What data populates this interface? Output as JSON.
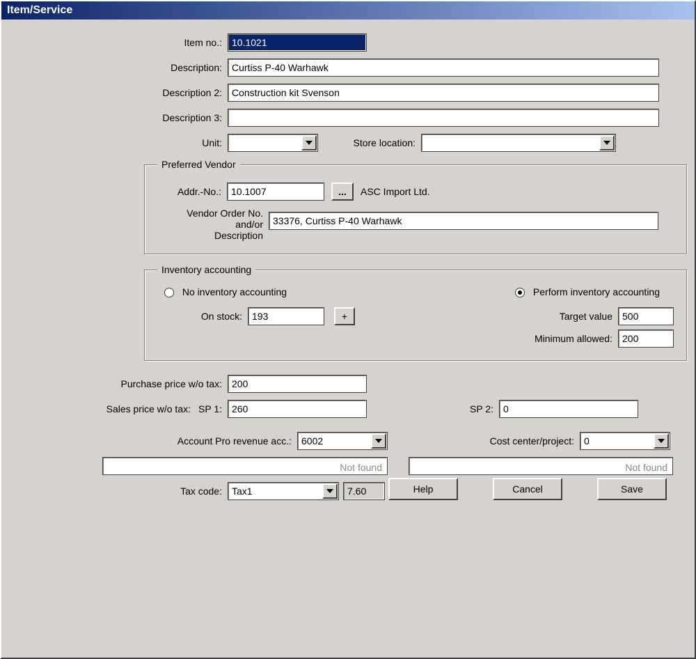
{
  "title": "Item/Service",
  "fields": {
    "item_no": {
      "label": "Item no.:",
      "value": "10.1021"
    },
    "description": {
      "label": "Description:",
      "value": "Curtiss P-40 Warhawk"
    },
    "description2": {
      "label": "Description 2:",
      "value": "Construction kit Svenson"
    },
    "description3": {
      "label": "Description 3:",
      "value": ""
    },
    "unit": {
      "label": "Unit:",
      "value": ""
    },
    "store_location": {
      "label": "Store location:",
      "value": ""
    }
  },
  "vendor": {
    "legend": "Preferred Vendor",
    "addr_no": {
      "label": "Addr.-No.:",
      "value": "10.1007"
    },
    "lookup_btn": "...",
    "vendor_name": "ASC Import Ltd.",
    "order": {
      "label1": "Vendor Order No. and/or",
      "label2": "Description",
      "value": "33376, Curtiss P-40 Warhawk"
    }
  },
  "inventory": {
    "legend": "Inventory accounting",
    "no_inv": "No inventory accounting",
    "perf_inv": "Perform inventory accounting",
    "on_stock": {
      "label": "On stock:",
      "value": "193",
      "btn": "+"
    },
    "target": {
      "label": "Target value",
      "value": "500"
    },
    "minimum": {
      "label": "Minimum allowed:",
      "value": "200"
    }
  },
  "pricing": {
    "purchase": {
      "label": "Purchase price w/o tax:",
      "value": "200"
    },
    "sales_label": "Sales price w/o tax:",
    "sp1": {
      "label": "SP 1:",
      "value": "260"
    },
    "sp2": {
      "label": "SP 2:",
      "value": "0"
    }
  },
  "account": {
    "revenue": {
      "label": "Account Pro revenue acc.:",
      "value": "6002",
      "not_found": "Not found"
    },
    "cost_center": {
      "label": "Cost center/project:",
      "value": "0",
      "not_found": "Not found"
    },
    "tax": {
      "label": "Tax code:",
      "value": "Tax1",
      "rate": "7.60",
      "pct": "%"
    }
  },
  "buttons": {
    "help": "Help",
    "cancel": "Cancel",
    "save": "Save"
  }
}
